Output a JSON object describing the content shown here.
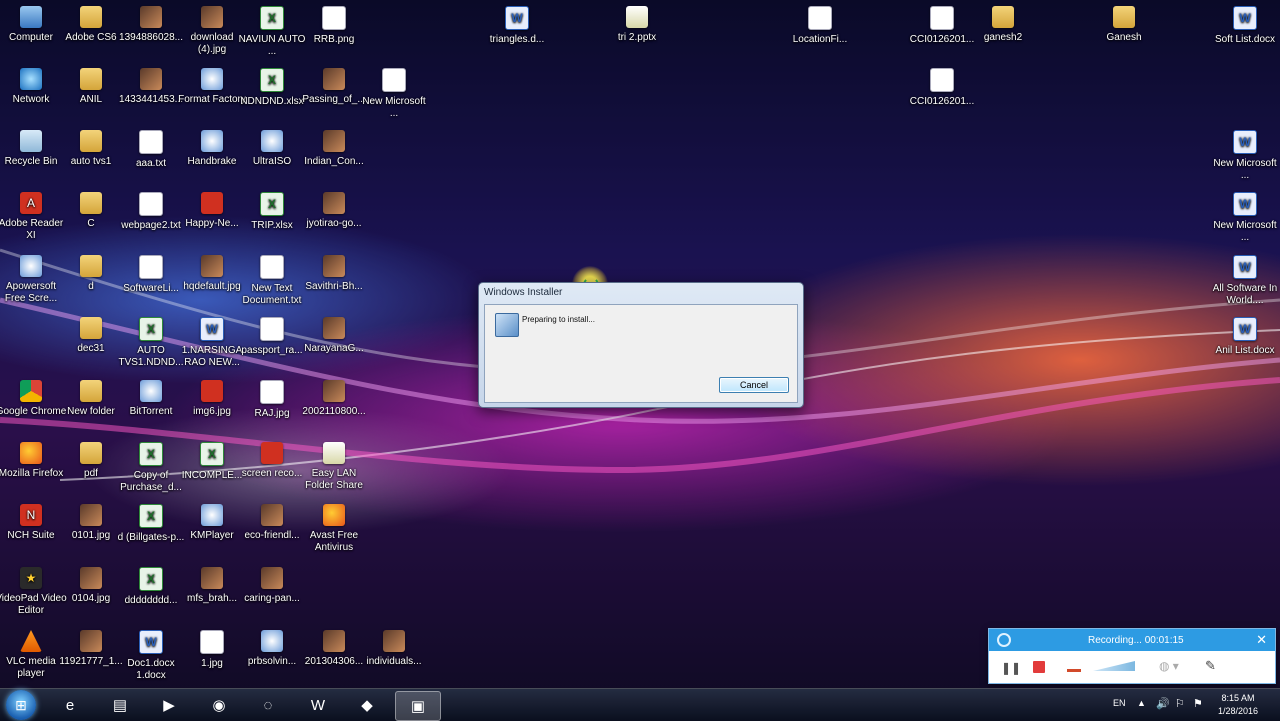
{
  "desktop_icons": [
    {
      "label": "Computer",
      "glyph": "g-pc"
    },
    {
      "label": "Network",
      "glyph": "g-net"
    },
    {
      "label": "Recycle Bin",
      "glyph": "g-bin"
    },
    {
      "label": "Adobe Reader XI",
      "glyph": "g-red",
      "text": "A"
    },
    {
      "label": "Apowersoft Free Scre...",
      "glyph": "g-app"
    },
    {
      "label": "Google Chrome",
      "glyph": "g-chrome"
    },
    {
      "label": "Mozilla Firefox",
      "glyph": "g-ff"
    },
    {
      "label": "NCH Suite",
      "glyph": "g-red",
      "text": "N"
    },
    {
      "label": "VideoPad Video Editor",
      "glyph": "g-star",
      "text": "★"
    },
    {
      "label": "VLC media player",
      "glyph": "g-vlc"
    },
    {
      "label": "Adobe CS6",
      "glyph": "g-folder"
    },
    {
      "label": "ANIL",
      "glyph": "g-folder"
    },
    {
      "label": "auto tvs1",
      "glyph": "g-folder"
    },
    {
      "label": "C",
      "glyph": "g-folder"
    },
    {
      "label": "d",
      "glyph": "g-folder"
    },
    {
      "label": "dec31",
      "glyph": "g-folder"
    },
    {
      "label": "New folder",
      "glyph": "g-folder"
    },
    {
      "label": "pdf",
      "glyph": "g-folder"
    },
    {
      "label": "0101.jpg",
      "glyph": "g-img"
    },
    {
      "label": "0104.jpg",
      "glyph": "g-img"
    },
    {
      "label": "11921777_1...",
      "glyph": "g-img"
    },
    {
      "label": "1394886028...",
      "glyph": "g-img"
    },
    {
      "label": "1433441453...",
      "glyph": "g-img"
    },
    {
      "label": "aaa.txt",
      "glyph": "g-doc"
    },
    {
      "label": "webpage2.txt",
      "glyph": "g-doc"
    },
    {
      "label": "SoftwareLi...",
      "glyph": "g-doc"
    },
    {
      "label": "AUTO TVS1.NDND...",
      "glyph": "g-xls",
      "text": "X"
    },
    {
      "label": "BitTorrent",
      "glyph": "g-app"
    },
    {
      "label": "Copy of Purchase_d...",
      "glyph": "g-xls",
      "text": "X"
    },
    {
      "label": "d (Billgates-p...",
      "glyph": "g-xls",
      "text": "X"
    },
    {
      "label": "dddddddd...",
      "glyph": "g-xls",
      "text": "X"
    },
    {
      "label": "Doc1.docx 1.docx",
      "glyph": "g-word",
      "text": "W"
    },
    {
      "label": "download (4).jpg",
      "glyph": "g-img"
    },
    {
      "label": "Format Factory",
      "glyph": "g-app"
    },
    {
      "label": "Handbrake",
      "glyph": "g-app"
    },
    {
      "label": "Happy-Ne...",
      "glyph": "g-red"
    },
    {
      "label": "hqdefault.jpg",
      "glyph": "g-img"
    },
    {
      "label": "1.NARSINGA RAO NEW...",
      "glyph": "g-word",
      "text": "W"
    },
    {
      "label": "img6.jpg",
      "glyph": "g-red"
    },
    {
      "label": "INCOMPLE...",
      "glyph": "g-xls",
      "text": "X"
    },
    {
      "label": "KMPlayer",
      "glyph": "g-app"
    },
    {
      "label": "mfs_brah...",
      "glyph": "g-img"
    },
    {
      "label": "1.jpg",
      "glyph": "g-doc"
    },
    {
      "label": "NAVIUN AUTO ...",
      "glyph": "g-xls",
      "text": "X"
    },
    {
      "label": "NDNDND.xlsx",
      "glyph": "g-xls",
      "text": "X"
    },
    {
      "label": "UltraISO",
      "glyph": "g-app"
    },
    {
      "label": "TRIP.xlsx",
      "glyph": "g-xls",
      "text": "X"
    },
    {
      "label": "New Text Document.txt",
      "glyph": "g-doc"
    },
    {
      "label": "passport_ra...",
      "glyph": "g-doc"
    },
    {
      "label": "RAJ.jpg",
      "glyph": "g-doc"
    },
    {
      "label": "screen reco...",
      "glyph": "g-red"
    },
    {
      "label": "eco-friendl...",
      "glyph": "g-img"
    },
    {
      "label": "caring-pan...",
      "glyph": "g-img"
    },
    {
      "label": "prbsolvin...",
      "glyph": "g-app"
    },
    {
      "label": "RRB.png",
      "glyph": "g-doc"
    },
    {
      "label": "Passing_of_...",
      "glyph": "g-img"
    },
    {
      "label": "Indian_Con...",
      "glyph": "g-img"
    },
    {
      "label": "jyotirao-go...",
      "glyph": "g-img"
    },
    {
      "label": "Savithri-Bh...",
      "glyph": "g-img"
    },
    {
      "label": "NarayanaG...",
      "glyph": "g-img"
    },
    {
      "label": "2002110800...",
      "glyph": "g-img"
    },
    {
      "label": "Easy LAN Folder Share",
      "glyph": "g-gold"
    },
    {
      "label": "Avast Free Antivirus",
      "glyph": "g-ff"
    },
    {
      "label": "201304306...",
      "glyph": "g-img"
    },
    {
      "label": "New Microsoft ...",
      "glyph": "g-doc"
    },
    {
      "label": "individuals...",
      "glyph": "g-img"
    },
    {
      "label": "triangles.d...",
      "glyph": "g-word",
      "text": "W"
    },
    {
      "label": "tri 2.pptx",
      "glyph": "g-gold"
    },
    {
      "label": "LocationFi...",
      "glyph": "g-doc"
    },
    {
      "label": "CCI0126201...",
      "glyph": "g-doc"
    },
    {
      "label": "CCI0126201...",
      "glyph": "g-doc"
    },
    {
      "label": "ganesh2",
      "glyph": "g-folder"
    },
    {
      "label": "Ganesh",
      "glyph": "g-folder"
    },
    {
      "label": "Soft List.docx",
      "glyph": "g-word",
      "text": "W"
    },
    {
      "label": "New Microsoft ...",
      "glyph": "g-word",
      "text": "W"
    },
    {
      "label": "New Microsoft ...",
      "glyph": "g-word",
      "text": "W"
    },
    {
      "label": "All Software In World....",
      "glyph": "g-word",
      "text": "W"
    },
    {
      "label": "Anil List.docx",
      "glyph": "g-word",
      "text": "W"
    }
  ],
  "dialog": {
    "title": "Windows Installer",
    "message": "Preparing to install...",
    "cancel_label": "Cancel"
  },
  "recorder": {
    "status": "Recording... 00:01:15",
    "close_glyph": "✕"
  },
  "taskbar": {
    "language": "EN",
    "time": "8:15 AM",
    "date": "1/28/2016",
    "buttons": [
      {
        "name": "ie",
        "glyph": "e"
      },
      {
        "name": "explorer",
        "glyph": "▤"
      },
      {
        "name": "media-player",
        "glyph": "▶"
      },
      {
        "name": "chrome",
        "glyph": "◉"
      },
      {
        "name": "bittorrent",
        "glyph": "◌"
      },
      {
        "name": "word",
        "glyph": "W"
      },
      {
        "name": "app",
        "glyph": "◆"
      },
      {
        "name": "installer",
        "glyph": "▣"
      }
    ]
  }
}
